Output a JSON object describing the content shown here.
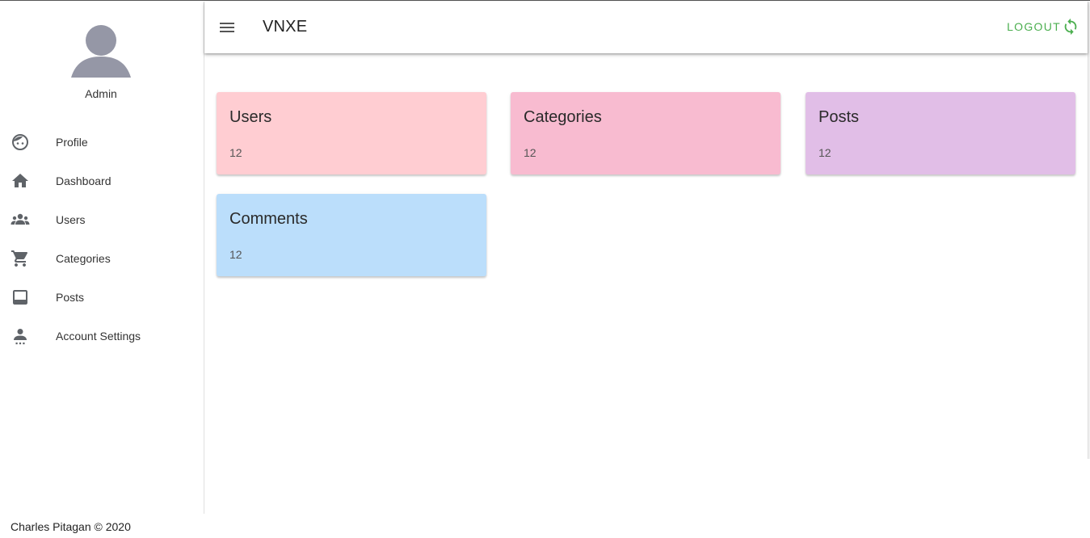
{
  "app": {
    "title": "VNXE",
    "logout_label": "LOGOUT",
    "accent_color": "#4caf50"
  },
  "sidebar": {
    "user_name": "Admin",
    "items": [
      {
        "label": "Profile",
        "icon": "face-icon"
      },
      {
        "label": "Dashboard",
        "icon": "home-icon"
      },
      {
        "label": "Users",
        "icon": "people-icon"
      },
      {
        "label": "Categories",
        "icon": "cart-icon"
      },
      {
        "label": "Posts",
        "icon": "tablet-icon"
      },
      {
        "label": "Account Settings",
        "icon": "account-settings-icon"
      }
    ]
  },
  "cards": [
    {
      "title": "Users",
      "count": "12",
      "color": "#ffcdd2"
    },
    {
      "title": "Categories",
      "count": "12",
      "color": "#f8bbd0"
    },
    {
      "title": "Posts",
      "count": "12",
      "color": "#e1bee7"
    },
    {
      "title": "Comments",
      "count": "12",
      "color": "#bbdefb"
    }
  ],
  "footer": {
    "text": "Charles Pitagan © 2020"
  }
}
